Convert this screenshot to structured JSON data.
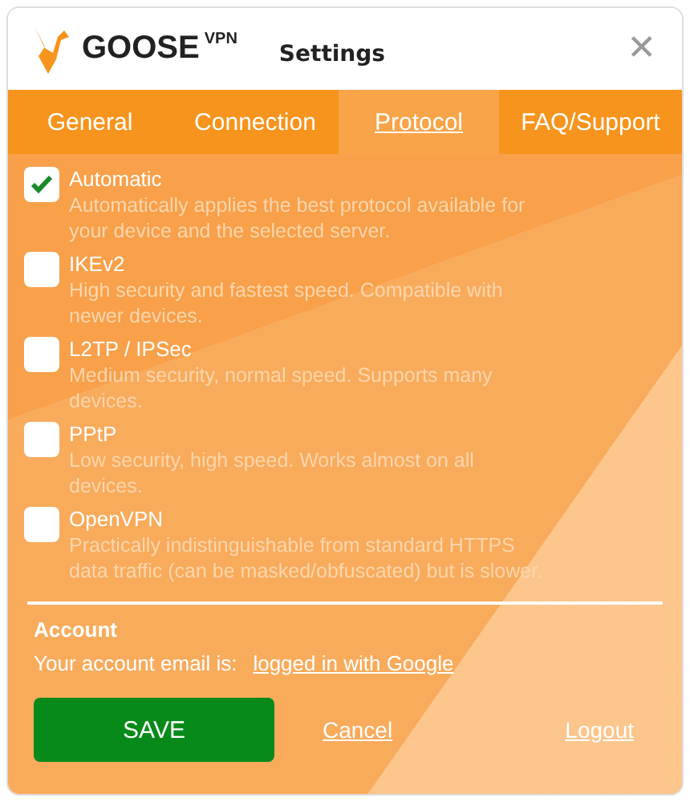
{
  "header": {
    "logo_name": "GOOSE",
    "logo_suffix": "VPN",
    "title": "Settings",
    "close": "✕"
  },
  "tabs": [
    {
      "label": "General",
      "selected": false
    },
    {
      "label": "Connection",
      "selected": false
    },
    {
      "label": "Protocol",
      "selected": true
    },
    {
      "label": "FAQ/Support",
      "selected": false
    }
  ],
  "protocols": [
    {
      "name": "Automatic",
      "checked": true,
      "description": "Automatically applies the best protocol available for your device and the selected server."
    },
    {
      "name": "IKEv2",
      "checked": false,
      "description": "High security and fastest speed. Compatible with newer devices."
    },
    {
      "name": "L2TP / IPSec",
      "checked": false,
      "description": "Medium security, normal speed. Supports many devices."
    },
    {
      "name": "PPtP",
      "checked": false,
      "description": "Low security, high speed. Works almost on all devices."
    },
    {
      "name": "OpenVPN",
      "checked": false,
      "description": "Practically indistinguishable from standard HTTPS data traffic (can be masked/obfuscated) but is slower."
    }
  ],
  "account": {
    "heading": "Account",
    "email_label": "Your account email is:",
    "email_link": "logged in with Google"
  },
  "buttons": {
    "save": "SAVE",
    "cancel": "Cancel",
    "logout": "Logout"
  }
}
